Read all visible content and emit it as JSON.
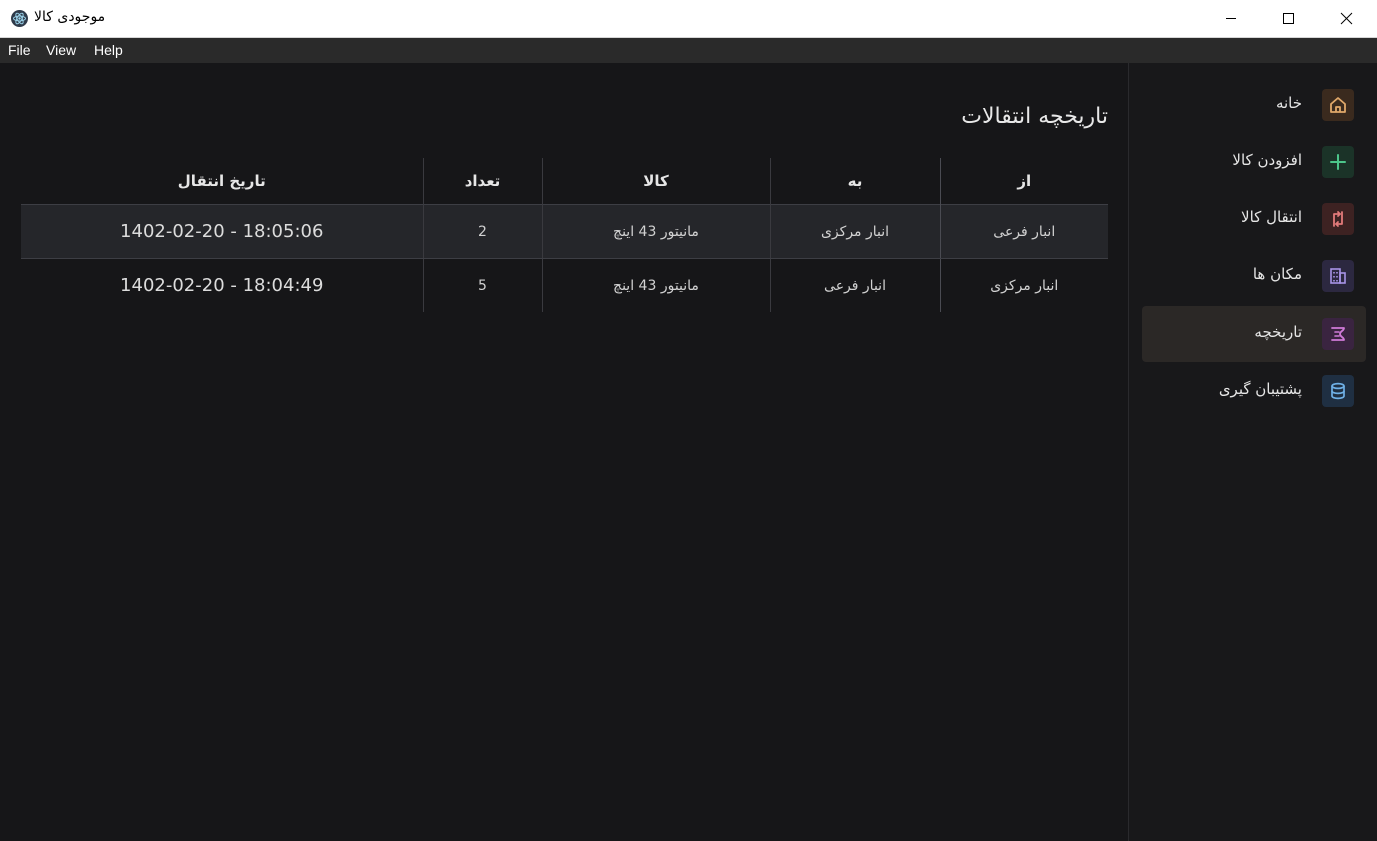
{
  "window": {
    "title": "موجودی کالا"
  },
  "menu": {
    "items": [
      "File",
      "View",
      "Help"
    ]
  },
  "sidebar": {
    "items": [
      {
        "label": "خانه",
        "icon": "home-icon",
        "color": "#e0a86a",
        "bg": "#3a2a1e",
        "active": false
      },
      {
        "label": "افزودن کالا",
        "icon": "plus-icon",
        "color": "#4cc58a",
        "bg": "#1b3328",
        "active": false
      },
      {
        "label": "انتقال کالا",
        "icon": "transfer-icon",
        "color": "#e27a7a",
        "bg": "#3d2222",
        "active": false
      },
      {
        "label": "مکان ها",
        "icon": "building-icon",
        "color": "#a894e8",
        "bg": "#2c2840",
        "active": false
      },
      {
        "label": "تاریخچه",
        "icon": "history-icon",
        "color": "#d07ad8",
        "bg": "#3a2440",
        "active": true
      },
      {
        "label": "پشتیبان گیری",
        "icon": "database-icon",
        "color": "#6fb0e6",
        "bg": "#1f2f42",
        "active": false
      }
    ]
  },
  "main": {
    "title": "تاریخچه انتقالات",
    "table": {
      "headers": {
        "from": "از",
        "to": "به",
        "item": "کالا",
        "qty": "تعداد",
        "date": "تاریخ انتقال"
      },
      "rows": [
        {
          "from": "انبار فرعی",
          "to": "انبار مرکزی",
          "item": "مانیتور 43 اینچ",
          "qty": "2",
          "date": "1402-02-20 - 18:05:06"
        },
        {
          "from": "انبار مرکزی",
          "to": "انبار فرعی",
          "item": "مانیتور 43 اینچ",
          "qty": "5",
          "date": "1402-02-20 - 18:04:49"
        }
      ]
    }
  },
  "colors": {
    "background": "#161618",
    "sidebar_active": "#2b2826",
    "row_highlight": "#25262a"
  }
}
